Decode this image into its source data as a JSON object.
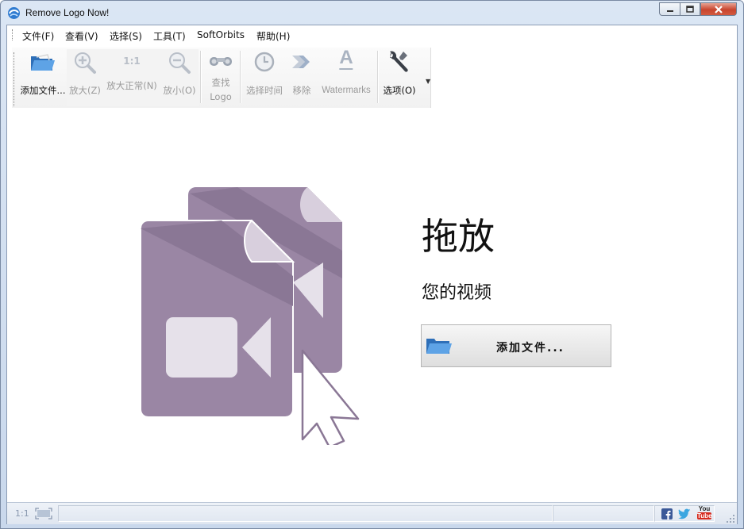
{
  "window": {
    "title": "Remove Logo Now!",
    "buttons": [
      "minimize",
      "maximize",
      "close"
    ]
  },
  "menu": [
    {
      "label": "文件(F)"
    },
    {
      "label": "查看(V)"
    },
    {
      "label": "选择(S)"
    },
    {
      "label": "工具(T)"
    },
    {
      "label": "SoftOrbits"
    },
    {
      "label": "帮助(H)"
    }
  ],
  "toolbar": {
    "add_files": "添加文件...",
    "zoom_in": "放大(Z)",
    "zoom_normal_icon_text": "1:1",
    "zoom_normal": "放大正常(N)",
    "zoom_out": "放小(O)",
    "find_logo_line1": "查找",
    "find_logo_line2": "Logo",
    "select_time": "选择时间",
    "remove": "移除",
    "watermark_icon_text": "A",
    "watermarks": "Watermarks",
    "options": "选项(O)"
  },
  "main": {
    "drop_title": "拖放",
    "drop_subtitle": "您的视频",
    "add_button": "添加文件..."
  },
  "status": {
    "zoom_label": "1:1",
    "social": [
      "facebook-icon",
      "twitter-icon",
      "youtube-icon"
    ],
    "youtube_text_top": "You",
    "youtube_text_bottom": "Tube"
  },
  "colors": {
    "art_purple": "#9a86a4",
    "art_dark": "#8a7795",
    "art_light": "#e6e1ea",
    "accent_blue": "#3a7cc0"
  }
}
